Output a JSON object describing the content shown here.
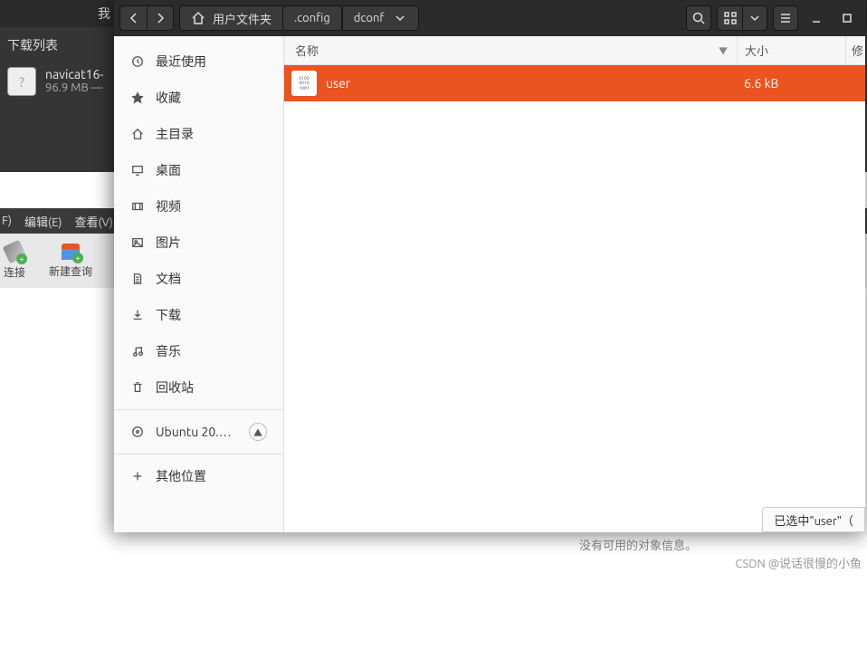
{
  "background": {
    "title_prefix": "我",
    "downloads_header": "下载列表",
    "download_item": {
      "name": "navicat16-",
      "size_line": "96.9 MB —"
    },
    "menu": {
      "file": "F)",
      "edit": "编辑(E)",
      "view": "查看(V)"
    },
    "icon_labels": {
      "connect": "连接",
      "new_query": "新建查询"
    },
    "no_info": "没有可用的对象信息。",
    "watermark": "CSDN @说话很慢的小鱼"
  },
  "fm": {
    "path": {
      "root_label": "用户文件夹",
      "seg1": ".config",
      "seg2": "dconf"
    },
    "sidebar": {
      "recent": "最近使用",
      "starred": "收藏",
      "home": "主目录",
      "desktop": "桌面",
      "videos": "视频",
      "pictures": "图片",
      "documents": "文档",
      "downloads": "下载",
      "music": "音乐",
      "trash": "回收站",
      "disk": "Ubuntu 20.0…",
      "other": "其他位置"
    },
    "columns": {
      "name": "名称",
      "size": "大小",
      "modified": "修"
    },
    "files": [
      {
        "name": "user",
        "size": "6.6 kB"
      }
    ],
    "status": "已选中\"user\"（"
  }
}
